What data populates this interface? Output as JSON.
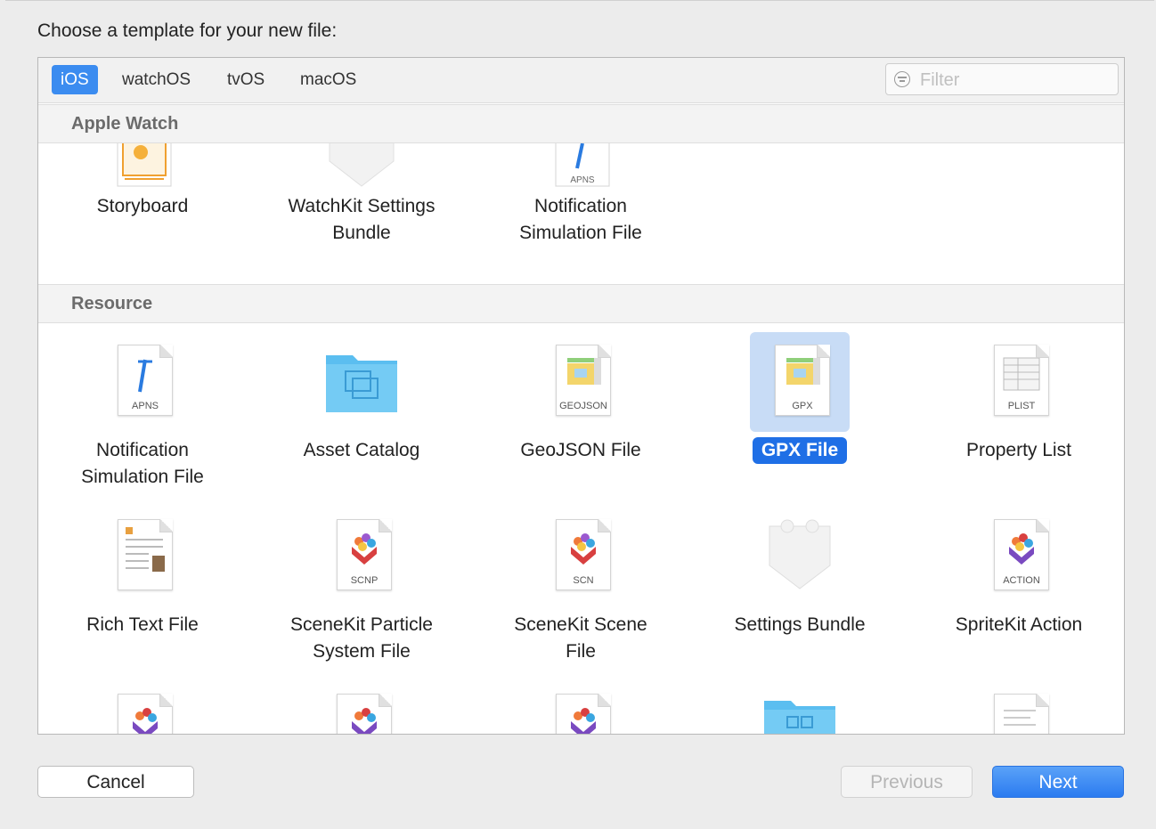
{
  "prompt": "Choose a template for your new file:",
  "tabs": [
    {
      "label": "iOS",
      "selected": true
    },
    {
      "label": "watchOS",
      "selected": false
    },
    {
      "label": "tvOS",
      "selected": false
    },
    {
      "label": "macOS",
      "selected": false
    }
  ],
  "filter": {
    "placeholder": "Filter"
  },
  "sections": [
    {
      "title": "Apple Watch",
      "items": [
        {
          "label": "Storyboard",
          "icon": "storyboard-icon"
        },
        {
          "label": "WatchKit Settings\nBundle",
          "icon": "settings-bundle-icon"
        },
        {
          "label": "Notification\nSimulation File",
          "icon": "apns-file-icon",
          "tag": "APNS"
        }
      ]
    },
    {
      "title": "Resource",
      "items": [
        {
          "label": "Notification\nSimulation File",
          "icon": "apns-file-icon",
          "tag": "APNS"
        },
        {
          "label": "Asset Catalog",
          "icon": "folder-icon"
        },
        {
          "label": "GeoJSON File",
          "icon": "geojson-file-icon",
          "tag": "GEOJSON"
        },
        {
          "label": "GPX File",
          "icon": "gpx-file-icon",
          "tag": "GPX",
          "selected": true
        },
        {
          "label": "Property List",
          "icon": "plist-file-icon",
          "tag": "PLIST"
        },
        {
          "label": "Rich Text File",
          "icon": "rich-text-file-icon"
        },
        {
          "label": "SceneKit Particle\nSystem File",
          "icon": "scnp-file-icon",
          "tag": "SCNP"
        },
        {
          "label": "SceneKit Scene\nFile",
          "icon": "scn-file-icon",
          "tag": "SCN"
        },
        {
          "label": "Settings Bundle",
          "icon": "settings-bundle-icon"
        },
        {
          "label": "SpriteKit Action",
          "icon": "action-file-icon",
          "tag": "ACTION"
        }
      ]
    }
  ],
  "buttons": {
    "cancel": "Cancel",
    "previous": "Previous",
    "next": "Next"
  },
  "colors": {
    "accent": "#1f6fe6",
    "selection_bg": "#c8dcf6",
    "tab_active": "#3b8cf0"
  }
}
